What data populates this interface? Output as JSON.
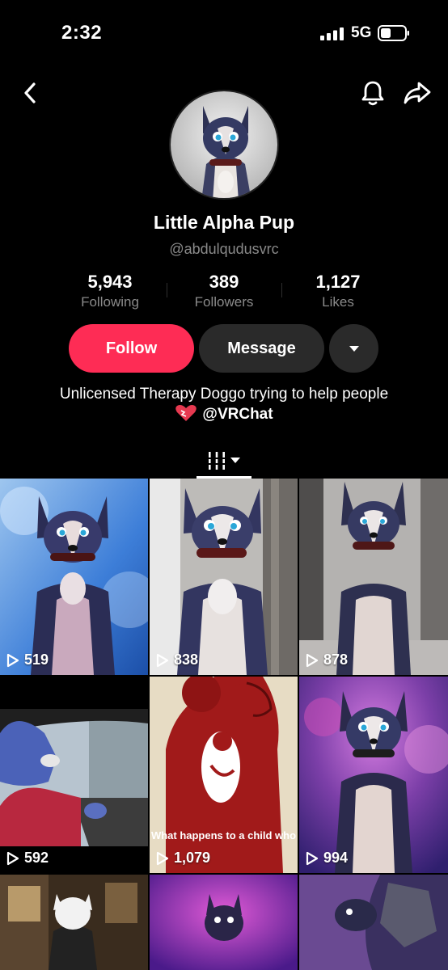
{
  "status_bar": {
    "time": "2:32",
    "network": "5G"
  },
  "profile": {
    "name": "Little Alpha Pup",
    "handle": "@abdulqudusvrc",
    "stats": [
      {
        "value": "5,943",
        "label": "Following"
      },
      {
        "value": "389",
        "label": "Followers"
      },
      {
        "value": "1,127",
        "label": "Likes"
      }
    ],
    "follow_label": "Follow",
    "message_label": "Message",
    "bio_line1": "Unlicensed Therapy Doggo trying to help people",
    "bio_link": "@VRChat"
  },
  "videos": [
    {
      "views": "519"
    },
    {
      "views": "838"
    },
    {
      "views": "878"
    },
    {
      "views": "592"
    },
    {
      "views": "1,079",
      "caption": "What happens to a child who"
    },
    {
      "views": "994"
    },
    {
      "views": ""
    },
    {
      "views": ""
    },
    {
      "views": ""
    }
  ],
  "colors": {
    "follow": "#fe2c55",
    "button_bg": "#2a2a2a",
    "muted": "#8a8a8a"
  }
}
